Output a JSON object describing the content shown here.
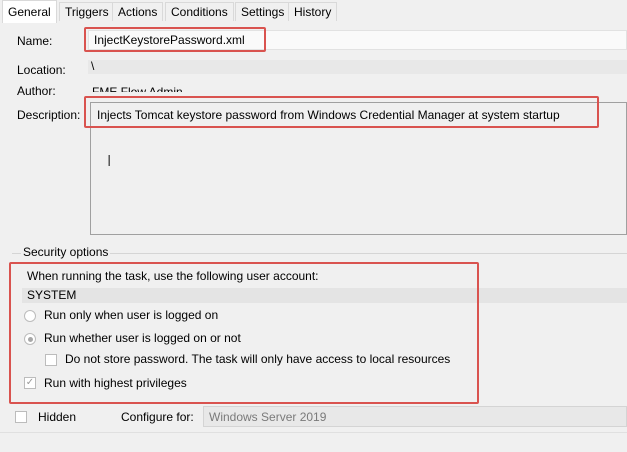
{
  "tabs": [
    "General",
    "Triggers",
    "Actions",
    "Conditions",
    "Settings",
    "History"
  ],
  "general": {
    "name_label": "Name:",
    "name_value": "InjectKeystorePassword.xml",
    "location_label": "Location:",
    "location_value": "\\",
    "author_label": "Author:",
    "author_value": "FME Flow Admin",
    "description_label": "Description:",
    "description_value": "Injects Tomcat keystore password from Windows Credential Manager at system startup"
  },
  "security": {
    "group_label": "Security options",
    "account_prompt": "When running the task, use the following user account:",
    "account_value": "SYSTEM",
    "run_logged_on": "Run only when user is logged on",
    "run_whether": "Run whether user is logged on or not",
    "no_store_password": "Do not store password.  The task will only have access to local resources",
    "highest_privileges": "Run with highest privileges"
  },
  "footer": {
    "hidden_label": "Hidden",
    "configure_label": "Configure for:",
    "configure_value": "Windows Server 2019"
  },
  "colors": {
    "highlight": "#d9534f"
  },
  "icons": {
    "text_cursor": "i-beam-cursor-icon",
    "checkmark": "checkmark-icon"
  }
}
